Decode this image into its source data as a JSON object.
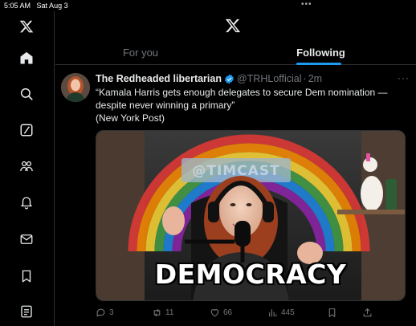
{
  "status_bar": {
    "time": "5:05 AM",
    "date": "Sat Aug 3"
  },
  "sidebar": {
    "items": [
      "x-logo-icon",
      "home-icon",
      "search-icon",
      "grok-icon",
      "communities-icon",
      "notifications-icon",
      "messages-icon",
      "bookmarks-icon",
      "lists-icon"
    ]
  },
  "tabs": [
    {
      "label": "For you",
      "active": false
    },
    {
      "label": "Following",
      "active": true
    }
  ],
  "tweet": {
    "display_name": "The Redheaded libertarian",
    "handle": "@TRHLofficial",
    "separator": "·",
    "timestamp": "2m",
    "text_line1": "“Kamala Harris gets enough delegates to secure Dem nomination — despite never winning a primary”",
    "text_line2": "(New York Post)",
    "media": {
      "overlay_text": "DEMOCRACY",
      "banner_text": "@TIMCAST"
    },
    "actions": {
      "replies": "3",
      "reposts": "11",
      "likes": "66",
      "views": "445"
    }
  },
  "colors": {
    "accent": "#1d9bf0",
    "muted": "#71767b",
    "border": "#2f3336",
    "background": "#000000"
  }
}
